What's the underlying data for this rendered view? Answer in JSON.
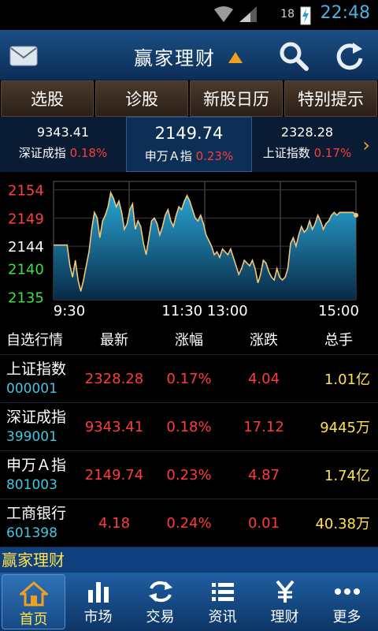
{
  "status": {
    "battery": "18",
    "time": "22:48"
  },
  "header": {
    "title": "赢家理财"
  },
  "tabs": [
    "选股",
    "诊股",
    "新股日历",
    "特别提示"
  ],
  "indices": [
    {
      "value": "9343.41",
      "name": "深证成指",
      "pct": "0.18%"
    },
    {
      "value": "2149.74",
      "name": "申万Ａ指",
      "pct": "0.23%"
    },
    {
      "value": "2328.28",
      "name": "上证指数",
      "pct": "0.17%"
    }
  ],
  "chart_data": {
    "type": "area",
    "y_ticks": [
      {
        "label": "2154",
        "value": 2154,
        "color": "#ff4040"
      },
      {
        "label": "2149",
        "value": 2149,
        "color": "#ff4040"
      },
      {
        "label": "2144",
        "value": 2144,
        "color": "#ffffff"
      },
      {
        "label": "2140",
        "value": 2140,
        "color": "#40e040"
      },
      {
        "label": "2135",
        "value": 2135,
        "color": "#40e040"
      }
    ],
    "x_ticks": [
      "9:30",
      "11:30 13:00",
      "15:00"
    ],
    "ylim": [
      2134.5,
      2155.5
    ],
    "grid": true,
    "values": [
      2144.2,
      2144.2,
      2144.2,
      2144.2,
      2144.2,
      2144.2,
      2140.5,
      2138.5,
      2141.5,
      2138.0,
      2136.0,
      2138.0,
      2140.5,
      2143.0,
      2147.0,
      2150.0,
      2149.0,
      2145.5,
      2148.5,
      2149.5,
      2151.0,
      2153.5,
      2152.5,
      2151.0,
      2152.0,
      2150.0,
      2147.0,
      2148.0,
      2150.5,
      2151.5,
      2147.0,
      2148.5,
      2147.5,
      2144.5,
      2142.5,
      2145.5,
      2148.5,
      2149.0,
      2148.0,
      2146.0,
      2147.5,
      2149.5,
      2150.5,
      2148.5,
      2147.5,
      2149.5,
      2151.0,
      2150.5,
      2152.0,
      2153.0,
      2152.0,
      2150.5,
      2149.0,
      2148.5,
      2149.5,
      2148.0,
      2146.0,
      2145.0,
      2144.0,
      2142.5,
      2143.0,
      2142.0,
      2143.5,
      2143.0,
      2142.5,
      2143.5,
      2142.0,
      2140.5,
      2139.0,
      2140.0,
      2141.5,
      2141.0,
      2140.5,
      2141.5,
      2140.0,
      2137.5,
      2139.0,
      2141.5,
      2141.0,
      2139.5,
      2138.5,
      2138.0,
      2140.0,
      2138.5,
      2138.0,
      2138.5,
      2140.0,
      2144.5,
      2145.5,
      2144.0,
      2146.0,
      2147.5,
      2146.5,
      2147.0,
      2148.5,
      2147.0,
      2148.0,
      2149.5,
      2148.5,
      2147.0,
      2148.0,
      2148.5,
      2149.5,
      2150.0,
      2149.5,
      2150.0,
      2150.0,
      2150.0,
      2150.0,
      2150.0,
      2150.0,
      2149.5
    ]
  },
  "table": {
    "headers": [
      "自选行情",
      "最新",
      "涨幅",
      "涨跌",
      "总手"
    ],
    "rows": [
      {
        "name": "上证指数",
        "code": "000001",
        "latest": "2328.28",
        "pct": "0.17%",
        "change": "4.04",
        "volume": "1.01亿"
      },
      {
        "name": "深证成指",
        "code": "399001",
        "latest": "9343.41",
        "pct": "0.18%",
        "change": "17.12",
        "volume": "9445万"
      },
      {
        "name": "申万Ａ指",
        "code": "801003",
        "latest": "2149.74",
        "pct": "0.23%",
        "change": "4.87",
        "volume": "1.74亿"
      },
      {
        "name": "工商银行",
        "code": "601398",
        "latest": "4.18",
        "pct": "0.24%",
        "change": "0.01",
        "volume": "40.38万"
      }
    ]
  },
  "ticker": "赢家理财",
  "nav": [
    "首页",
    "市场",
    "交易",
    "资讯",
    "理财",
    "更多"
  ],
  "colors": {
    "up": "#ff3b3b",
    "accent": "#f0a020",
    "code": "#3fc8e0",
    "volume": "#ffe34a"
  }
}
